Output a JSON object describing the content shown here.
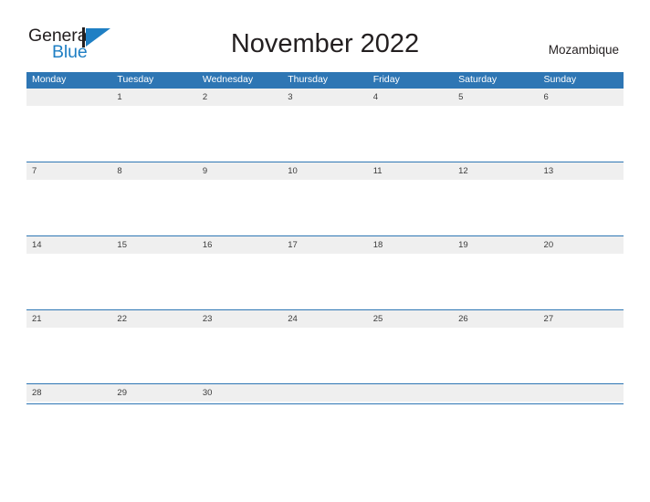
{
  "brand": {
    "word_one": "General",
    "word_two": "Blue",
    "mark_icon": "triangle-flag-icon",
    "accent_color": "#1f7fc4",
    "text_color": "#231f20"
  },
  "header": {
    "title": "November 2022",
    "country": "Mozambique"
  },
  "calendar": {
    "header_color": "#2e76b4",
    "date_band_color": "#efefef",
    "weekdays": [
      "Monday",
      "Tuesday",
      "Wednesday",
      "Thursday",
      "Friday",
      "Saturday",
      "Sunday"
    ],
    "weeks": [
      {
        "days": [
          "",
          "1",
          "2",
          "3",
          "4",
          "5",
          "6"
        ]
      },
      {
        "days": [
          "7",
          "8",
          "9",
          "10",
          "11",
          "12",
          "13"
        ]
      },
      {
        "days": [
          "14",
          "15",
          "16",
          "17",
          "18",
          "19",
          "20"
        ]
      },
      {
        "days": [
          "21",
          "22",
          "23",
          "24",
          "25",
          "26",
          "27"
        ]
      },
      {
        "days": [
          "28",
          "29",
          "30",
          "",
          "",
          "",
          ""
        ]
      }
    ]
  }
}
